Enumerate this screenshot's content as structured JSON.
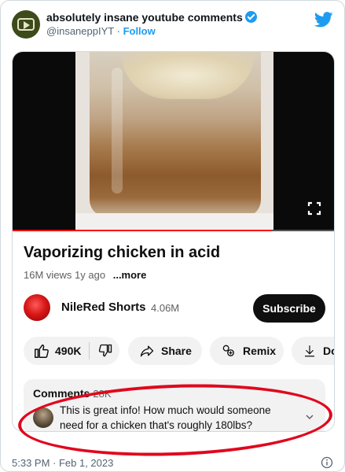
{
  "tweet": {
    "account_name": "absolutely insane youtube comments",
    "handle": "@insaneppIYT",
    "separator": "·",
    "follow_label": "Follow",
    "timestamp": "5:33 PM · Feb 1, 2023"
  },
  "video": {
    "title": "Vaporizing chicken in acid",
    "views": "16M views",
    "age": "1y ago",
    "more_label": "...more",
    "progress_fraction": 0.8
  },
  "channel": {
    "name": "NileRed Shorts",
    "subscribers": "4.06M",
    "subscribe_label": "Subscribe"
  },
  "actions": {
    "likes": "490K",
    "share_label": "Share",
    "remix_label": "Remix",
    "download_label": "Do"
  },
  "comments": {
    "label": "Comments",
    "count": "28K",
    "top_comment": "This is great info! How much would someone need for a chicken that's roughly 180lbs?"
  },
  "colors": {
    "twitter_blue": "#1d9bf0",
    "youtube_red": "#ff0000",
    "annotation_red": "#e0071d"
  }
}
